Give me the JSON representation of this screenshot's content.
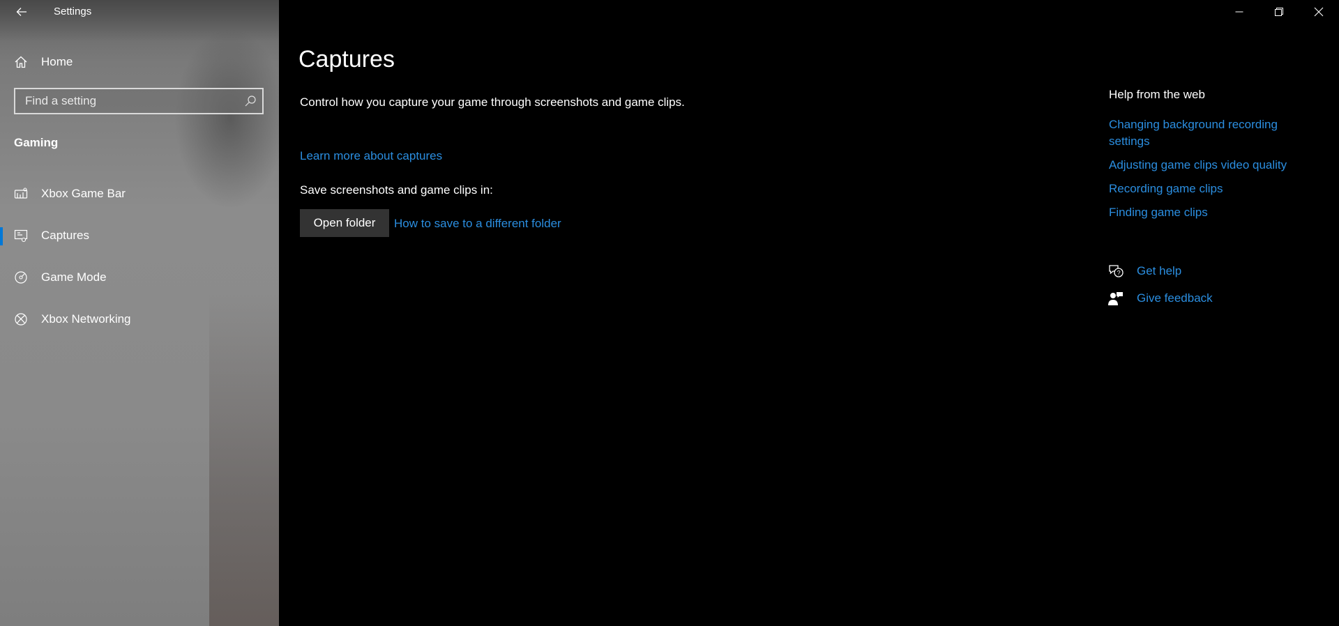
{
  "window": {
    "title": "Settings",
    "controls": {
      "minimize": "minimize-icon",
      "restore": "restore-icon",
      "close": "close-icon"
    }
  },
  "sidebar": {
    "home_label": "Home",
    "search_placeholder": "Find a setting",
    "section_title": "Gaming",
    "items": [
      {
        "label": "Xbox Game Bar",
        "icon": "game-bar-icon",
        "selected": false
      },
      {
        "label": "Captures",
        "icon": "captures-icon",
        "selected": true
      },
      {
        "label": "Game Mode",
        "icon": "game-mode-icon",
        "selected": false
      },
      {
        "label": "Xbox Networking",
        "icon": "xbox-icon",
        "selected": false
      }
    ]
  },
  "main": {
    "title": "Captures",
    "description": "Control how you capture your game through screenshots and game clips.",
    "learn_more_link": "Learn more about captures",
    "save_label": "Save screenshots and game clips in:",
    "open_folder_button": "Open folder",
    "how_to_save_link": "How to save to a different folder"
  },
  "help": {
    "title": "Help from the web",
    "links": [
      "Changing background recording settings",
      "Adjusting game clips video quality",
      "Recording game clips",
      "Finding game clips"
    ],
    "get_help": "Get help",
    "give_feedback": "Give feedback"
  },
  "colors": {
    "accent": "#0078d7",
    "link": "#2b8ee0",
    "background": "#000000",
    "button": "#333333"
  }
}
